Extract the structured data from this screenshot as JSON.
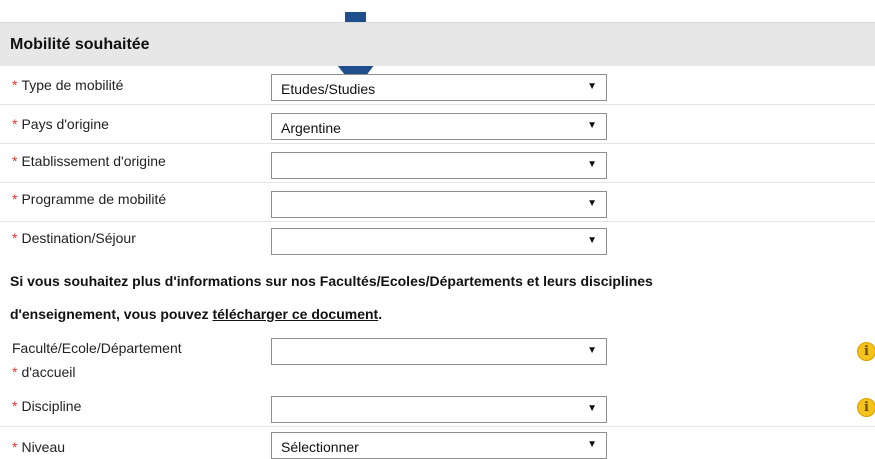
{
  "section": {
    "title": "Mobilité souhaitée"
  },
  "required_mark": "*",
  "fields": {
    "type_mobilite": {
      "label": "Type de mobilité",
      "value": "Etudes/Studies"
    },
    "pays_origine": {
      "label": "Pays d'origine",
      "value": "Argentine"
    },
    "etablissement_origine": {
      "label": "Etablissement d'origine",
      "value": ""
    },
    "programme_mobilite": {
      "label": "Programme de mobilité",
      "value": ""
    },
    "destination_sejour": {
      "label": "Destination/Séjour",
      "value": ""
    },
    "faculte": {
      "label_line1": "Faculté/Ecole/Département",
      "label_line2": "d'accueil",
      "value": ""
    },
    "discipline": {
      "label": "Discipline",
      "value": ""
    },
    "niveau": {
      "label": "Niveau",
      "value": "Sélectionner"
    }
  },
  "info_paragraph": {
    "line1": "Si vous souhaitez plus d'informations sur nos Facultés/Ecoles/Départements et leurs disciplines",
    "line2_prefix": "d'enseignement, vous pouvez ",
    "link_text": "télécharger ce document",
    "line2_suffix": "."
  },
  "dropdown_caret": "▼",
  "info_icon_glyph": "i",
  "colors": {
    "header_bg": "#e7e7e7",
    "required": "#e3342f",
    "arrow": "#1f4e8c",
    "info_icon": "#f4c21a"
  },
  "icons": [
    "down-arrow-annotation-icon",
    "dropdown-caret-icon",
    "info-icon"
  ]
}
